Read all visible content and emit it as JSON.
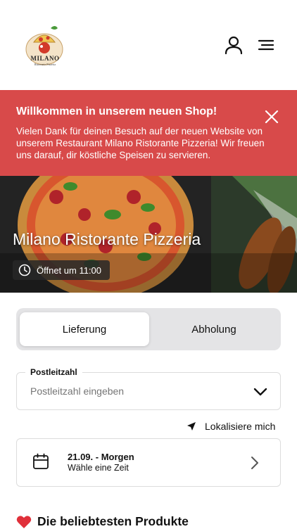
{
  "header": {
    "logo_text": "MILANO",
    "logo_subtext": "Ristorante Pizzeria",
    "account_icon": "user-icon",
    "menu_icon": "hamburger-menu-icon"
  },
  "banner": {
    "title": "Willkommen in unserem neuen Shop!",
    "text": "Vielen Dank für deinen Besuch auf der neuen Website von unserem Restaurant Milano Ristorante Pizzeria! Wir freuen uns darauf, dir köstliche Speisen zu servieren.",
    "close_icon": "close-icon",
    "color": "#d84a4a"
  },
  "hero": {
    "title": "Milano Ristorante Pizzeria",
    "hours": "Öffnet um 11:00",
    "hours_icon": "clock-icon"
  },
  "order_mode": {
    "options": [
      "Lieferung",
      "Abholung"
    ],
    "selected": "Lieferung"
  },
  "zip": {
    "label": "Postleitzahl",
    "placeholder": "Postleitzahl eingeben",
    "value": ""
  },
  "locate": {
    "label": "Lokalisiere mich",
    "icon": "location-arrow-icon"
  },
  "time_picker": {
    "date": "21.09. - Morgen",
    "hint": "Wähle eine Zeit",
    "icon": "calendar-icon"
  },
  "section": {
    "title": "Die beliebtesten Produkte",
    "icon": "heart-icon",
    "icon_color": "#e0303a"
  }
}
